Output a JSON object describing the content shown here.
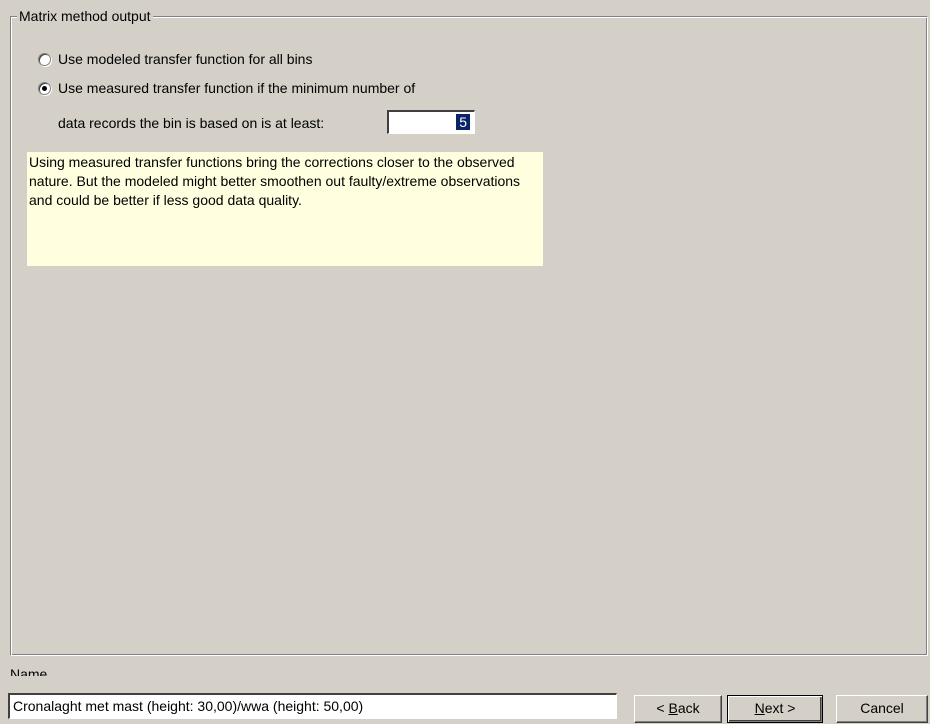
{
  "group": {
    "title": "Matrix method output"
  },
  "options": [
    {
      "label": "Use modeled transfer function for all bins",
      "checked": false
    },
    {
      "label": "Use measured transfer function if the minimum number of",
      "checked": true
    }
  ],
  "min_records": {
    "label": "data records the bin is based on is at least:",
    "value": "5"
  },
  "info_text": "Using measured transfer functions bring the corrections closer to the observed nature. But the modeled might better smoothen out faulty/extreme observations and could be better if less good data quality.",
  "name": {
    "label": "Name",
    "value": "Cronalaght met mast (height: 30,00)/wwa (height: 50,00)"
  },
  "buttons": {
    "back_prefix": "< ",
    "back_key": "B",
    "back_rest": "ack",
    "next_key": "N",
    "next_rest": "ext >",
    "cancel": "Cancel"
  }
}
